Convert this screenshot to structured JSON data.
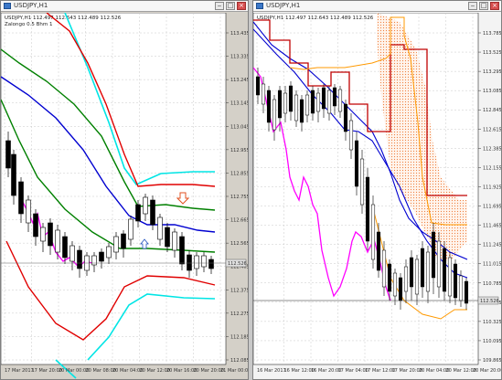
{
  "left": {
    "window_title": "USDJPY,H1",
    "info_line": "USDJPY,H1 112.497 112.643 112.489 112.526",
    "indicator_line": "Zalongo 0.5 Bhm 1",
    "current_price": "112.526",
    "price_labels": [
      "113.435",
      "113.335",
      "113.245",
      "113.145",
      "113.045",
      "112.955",
      "112.855",
      "112.755",
      "112.665",
      "112.565",
      "112.465",
      "112.375",
      "112.275",
      "112.185",
      "112.085"
    ],
    "time_labels": [
      "17 Mar 2017",
      "17 Mar 20:00",
      "20 Mar 00:00",
      "20 Mar 08:00",
      "20 Mar 04:00",
      "20 Mar 12:00",
      "20 Mar 16:00",
      "20 Mar 20:00",
      "21 Mar 00:00"
    ]
  },
  "right": {
    "window_title": "USDJPY,H1",
    "info_line": "USDJPY,H1 112.497 112.643 112.489 112.526",
    "current_price": "112.526",
    "price_labels": [
      "113.785",
      "113.525",
      "113.295",
      "113.085",
      "112.845",
      "112.615",
      "112.385",
      "112.155",
      "111.925",
      "111.695",
      "111.465",
      "111.245",
      "111.015",
      "110.785",
      "110.555",
      "110.325",
      "110.095",
      "109.865"
    ],
    "time_labels": [
      "16 Mar 2017",
      "16 Mar 12:00",
      "16 Mar 20:00",
      "17 Mar 04:00",
      "17 Mar 12:00",
      "17 Mar 20:00",
      "20 Mar 04:00",
      "20 Mar 12:00",
      "20 Mar 20:00"
    ]
  },
  "colors": {
    "candle_up": "#ffffff",
    "candle_down": "#000000",
    "bb_outer": "#00e5e5",
    "bb_mid_outer": "#e00000",
    "bb_inner": "#008000",
    "ma": "#0000d0",
    "chikou": "#ff00ff",
    "ichimoku_cloud": "#ffa070",
    "ichimoku_band": "#ff9900",
    "kijun": "#c00000"
  }
}
